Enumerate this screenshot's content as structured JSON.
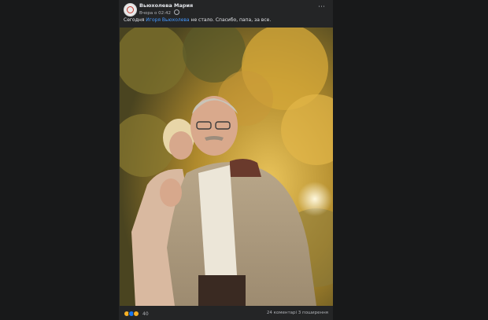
{
  "post": {
    "author": "Вьюхолева Мария",
    "time": "Вчора о 02:42",
    "text_before": "Сегодня ",
    "mention": "Игоря Вьюхолева",
    "text_after": " не стало.  Спасибо, папа, за все."
  },
  "footer": {
    "reactions_count": "40",
    "comments": "24 коментарі",
    "shares": "3 поширення",
    "reaction_icons": [
      "sad-icon",
      "like-icon",
      "care-icon"
    ]
  },
  "colors": {
    "background": "#18191a",
    "card": "#242526",
    "link": "#4599ff",
    "text": "#e4e6eb",
    "secondary_text": "#b0b3b8"
  }
}
